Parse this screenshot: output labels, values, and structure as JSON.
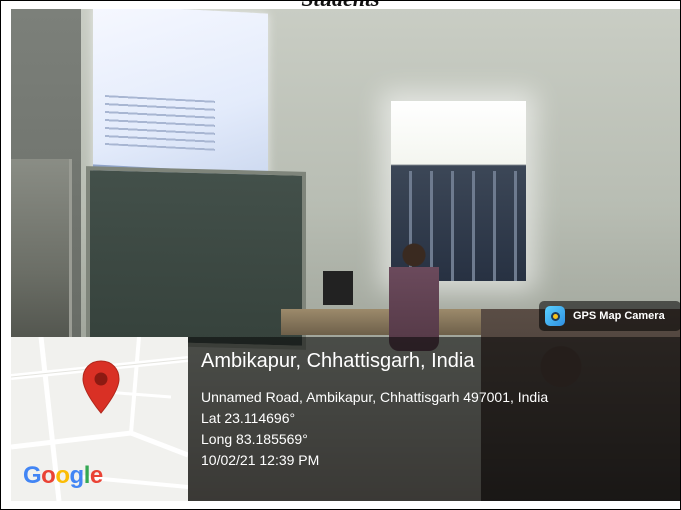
{
  "caption": {
    "text": "Students"
  },
  "camera_tag": {
    "label": "GPS Map Camera",
    "icon": "gps-map-camera-icon"
  },
  "location": {
    "title": "Ambikapur, Chhattisgarh, India",
    "address": "Unnamed Road, Ambikapur, Chhattisgarh 497001, India",
    "lat": "Lat 23.114696°",
    "long": "Long 83.185569°",
    "datetime": "10/02/21 12:39 PM"
  },
  "map": {
    "brand": "Google",
    "pin_color": "#d93025",
    "brand_colors": [
      "#4285F4",
      "#EA4335",
      "#FBBC05",
      "#4285F4",
      "#34A853",
      "#EA4335"
    ]
  }
}
